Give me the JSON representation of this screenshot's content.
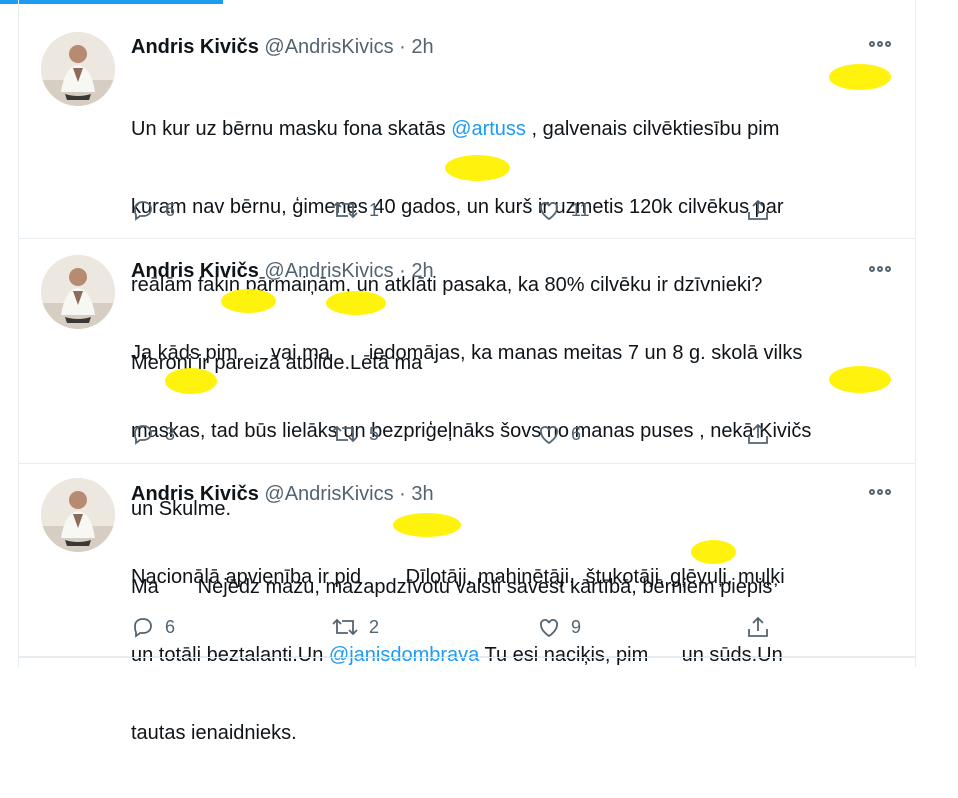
{
  "tweets": [
    {
      "name": "Andris Kivičs",
      "handle": "@AndrisKivics",
      "dot": "·",
      "time": "2h",
      "body_lines": [
        [
          "Un kur uz bērnu masku fona skatās ",
          {
            "mention": "@artuss"
          },
          " , galvenais cilvēktiesību pim"
        ],
        [
          "kuram nav bērnu, ģimenes 40 gados, un kurš ir uzmetis 120k cilvēkus par"
        ],
        [
          "reālām fakin pārmaiņām, un atklāti pasaka, ka 80% cilvēku ir dzīvnieki?"
        ],
        [
          "Meroni ir pareizā atbilde.Lētā ma"
        ]
      ],
      "replies": "6",
      "retweets": "1",
      "likes": "11"
    },
    {
      "name": "Andris Kivičs",
      "handle": "@AndrisKivics",
      "dot": "·",
      "time": "2h",
      "body_lines": [
        [
          "Ja kāds pim      vai ma       iedomājas, ka manas meitas 7 un 8 g. skolā vilks"
        ],
        [
          "maskas, tad būs lielāks un bezpriģeļnāks šovs no manas puses , nekā Kivičs"
        ],
        [
          "un Skulme."
        ],
        [
          "Ma       Nejēdz mazu, mazapdzīvotu valsti savest kārtībā, bērniem piepis"
        ]
      ],
      "replies": "3",
      "retweets": "5",
      "likes": "6"
    },
    {
      "name": "Andris Kivičs",
      "handle": "@AndrisKivics",
      "dot": "·",
      "time": "3h",
      "body_lines": [
        [
          "Nacionālā apvienība ir pid        Dīlotāji, mahinētāji,  štukotāji, gļēvuļi, muļķi"
        ],
        [
          "un totāli beztalanti.Un ",
          {
            "mention": "@janisdombrava"
          },
          " Tu esi naciķis, pim      un sūds.Un"
        ],
        [
          "tautas ienaidnieks."
        ]
      ],
      "replies": "6",
      "retweets": "2",
      "likes": "9"
    }
  ],
  "icons": {
    "more": "more-horizontal-icon",
    "reply": "reply-icon",
    "retweet": "retweet-icon",
    "like": "heart-icon",
    "share": "share-icon"
  },
  "colors": {
    "accent": "#1d9bf0",
    "censor": "#fff200",
    "secondary": "#536471"
  }
}
